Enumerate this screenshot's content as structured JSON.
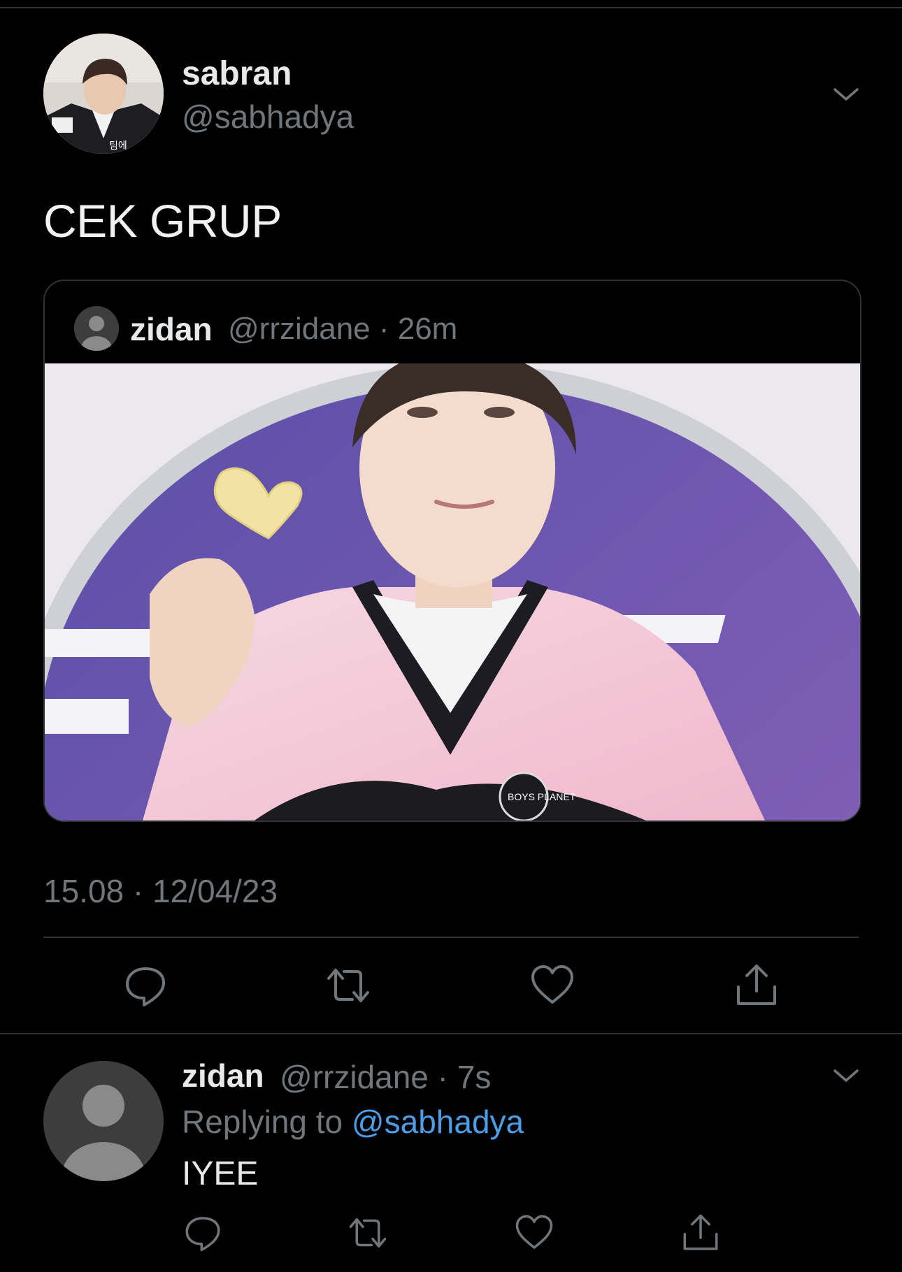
{
  "main_tweet": {
    "name": "sabran",
    "handle": "@sabhadya",
    "text": "CEK GRUP",
    "avatar_caption": "팀에",
    "timestamp": "15.08 · 12/04/23"
  },
  "quoted_tweet": {
    "name": "zidan",
    "handle_time": "@rrzidane · 26m",
    "image_badge": "BOYS PLANET"
  },
  "reply": {
    "name": "zidan",
    "handle_time": "@rrzidane · 7s",
    "replying_prefix": "Replying to",
    "replying_mention": "@sabhadya",
    "text": "IYEE"
  },
  "icons": [
    "chevron-down-icon",
    "reply-icon",
    "retweet-icon",
    "like-icon",
    "share-icon"
  ],
  "colors": {
    "background": "#000000",
    "secondary_text": "#71767b",
    "mention": "#4a9ee8",
    "divider": "#2f3336"
  }
}
